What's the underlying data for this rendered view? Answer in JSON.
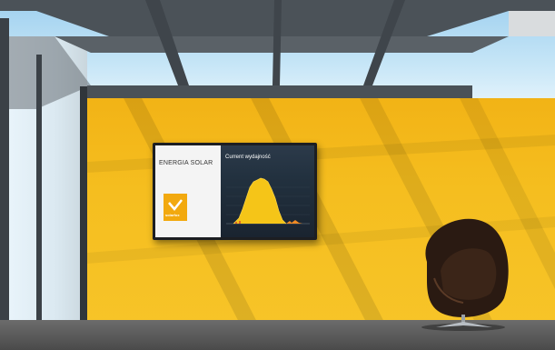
{
  "photo": {
    "subject": "Yellow-walled sunroom with a wall-mounted screen showing a solar energy dashboard and a dark egg-shaped lounge chair",
    "colors": {
      "wall": "#f5be1f",
      "sky": "#bfe2f5",
      "steel": "#4b5258",
      "floor": "#585858",
      "chart_fill": "#f5c518",
      "chair": "#2a1a12"
    }
  },
  "screen": {
    "left_panel": {
      "company_line": "",
      "title": "ENERGIA SOLAR",
      "caption": "",
      "logo_text": "solarfox",
      "logo_icon": "sun-check-icon"
    },
    "right_panel": {
      "title": "Current wydajność",
      "subtitle": "",
      "corner_label": ""
    }
  }
}
